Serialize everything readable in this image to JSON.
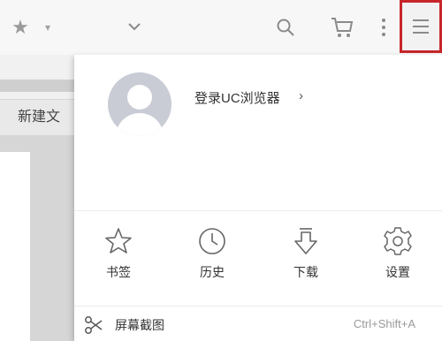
{
  "background_tab": {
    "label": "新建文"
  },
  "user": {
    "login_label": "登录UC浏览器",
    "login_arrow": "›"
  },
  "quick_actions": [
    {
      "icon": "star-icon",
      "label": "书签"
    },
    {
      "icon": "clock-icon",
      "label": "历史"
    },
    {
      "icon": "download-icon",
      "label": "下载"
    },
    {
      "icon": "gear-icon",
      "label": "设置"
    }
  ],
  "screenshot": {
    "label": "屏幕截图",
    "shortcut": "Ctrl+Shift+A"
  },
  "colors": {
    "highlight_border": "#c7262b",
    "avatar": "#c9ccd4"
  }
}
